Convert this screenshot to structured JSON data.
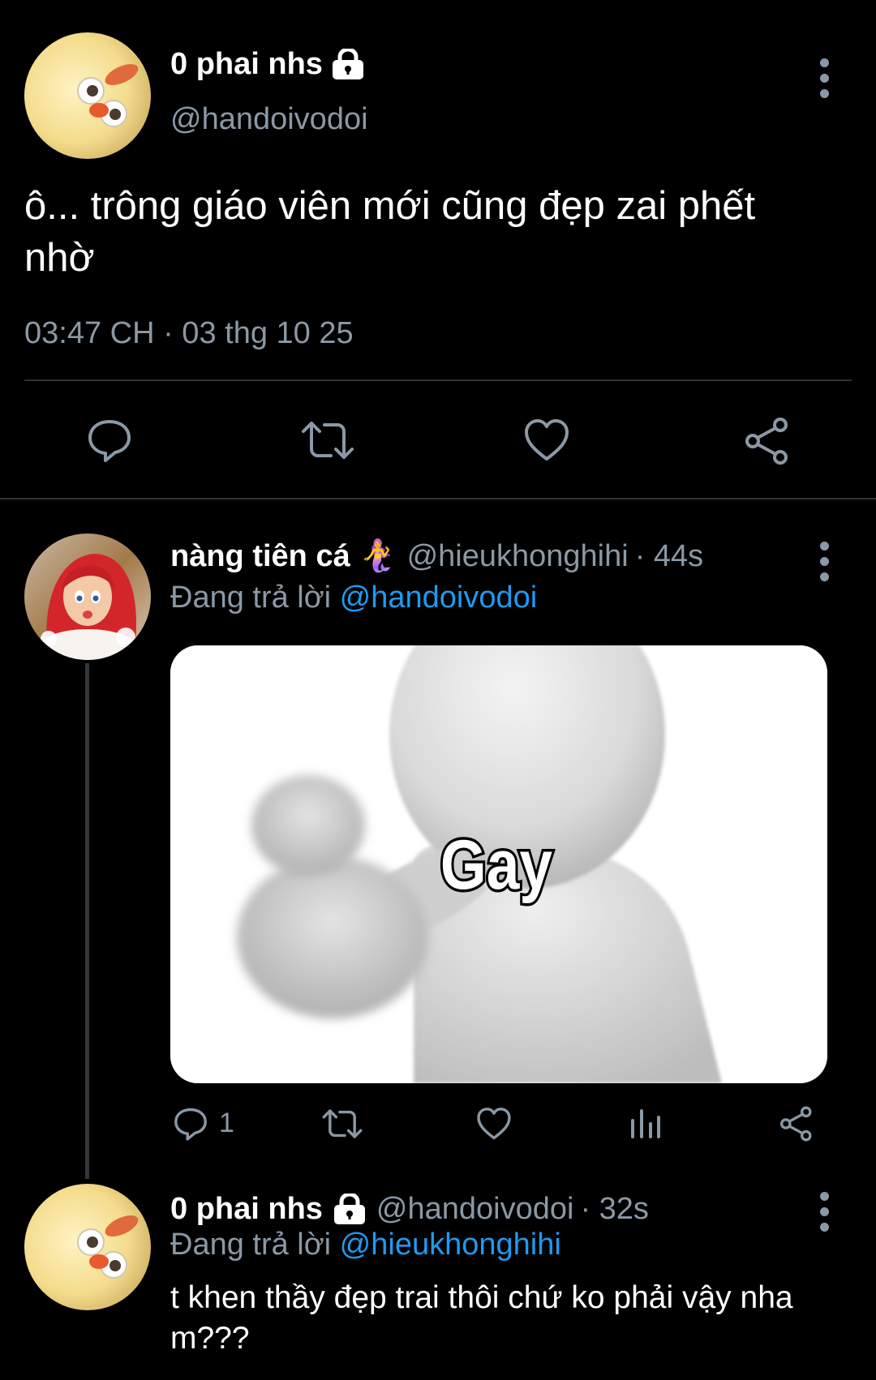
{
  "main_tweet": {
    "display_name": "0 phai nhs",
    "handle": "@handoivodoi",
    "text": "ô... trông giáo viên mới cũng đẹp zai phết nhờ",
    "timestamp": "03:47 CH · 03 thg 10 25",
    "icons": [
      "reply-icon",
      "retweet-icon",
      "like-icon",
      "share-icon"
    ]
  },
  "reply1": {
    "display_name": "nàng tiên cá 🧜‍♀️",
    "handle": "@hieukhonghihi",
    "time": "· 44s",
    "replying_prefix": "Đang trả lời",
    "replying_to": "@handoivodoi",
    "image_caption": "Gay",
    "reply_count": "1",
    "icons": [
      "reply-icon",
      "retweet-icon",
      "like-icon",
      "views-icon",
      "share-icon"
    ]
  },
  "reply2": {
    "display_name": "0 phai nhs",
    "handle": "@handoivodoi",
    "time": "· 32s",
    "replying_prefix": "Đang trả lời",
    "replying_to": "@hieukhonghihi",
    "text": "t khen thầy đẹp trai thôi chứ ko phải vậy nha m???"
  },
  "colors": {
    "background": "#000000",
    "text": "#e7e9ea",
    "muted": "#8b98a5",
    "link": "#1d9bf0",
    "divider": "#2f3336"
  }
}
